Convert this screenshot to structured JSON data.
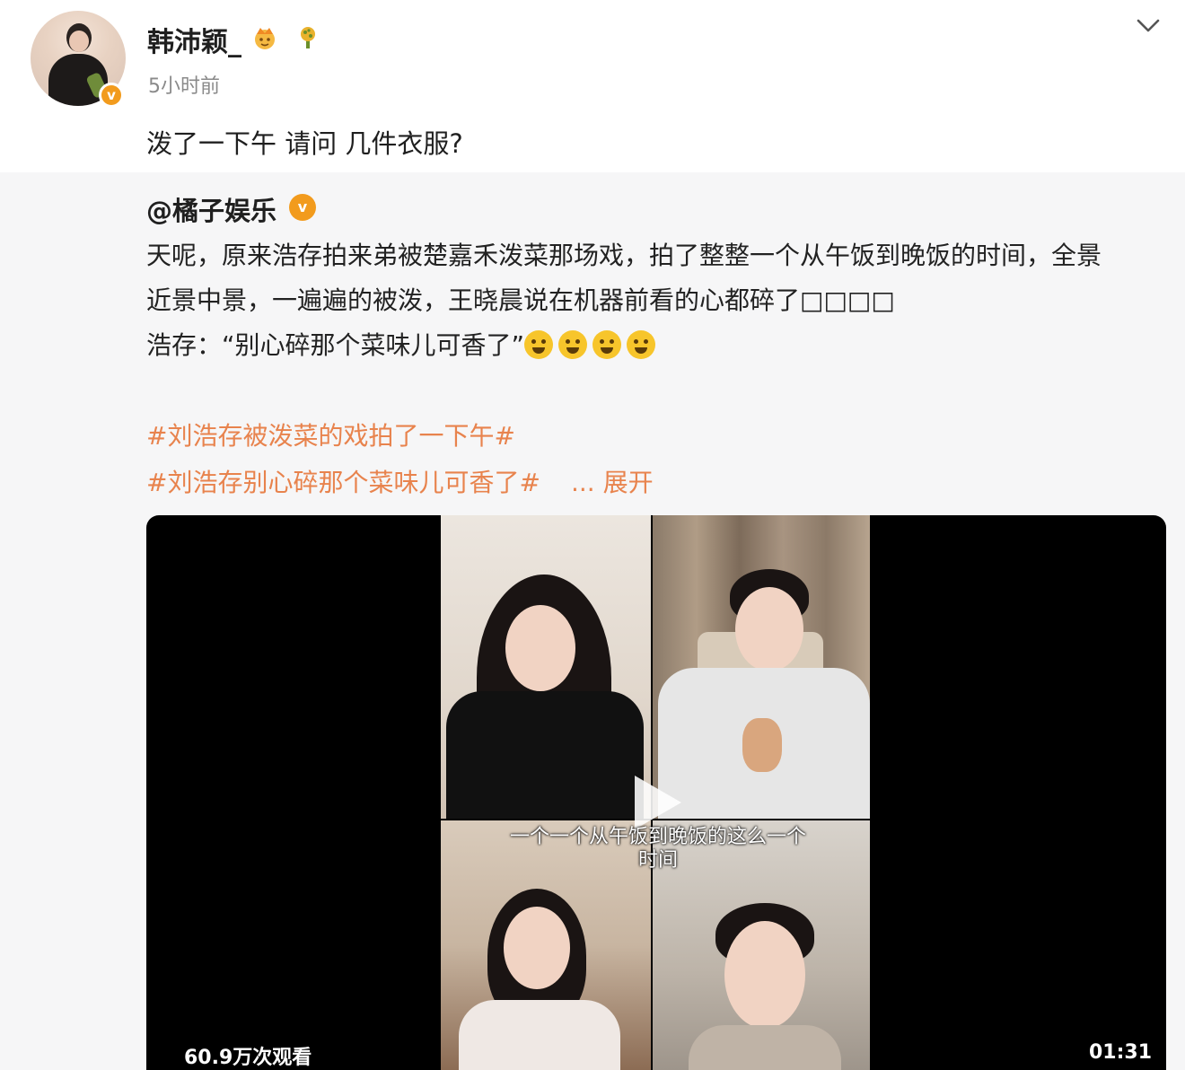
{
  "post": {
    "username": "韩沛颖_",
    "time": "5小时前",
    "text": "泼了一下午 请问 几件衣服?",
    "verify_badge": "v"
  },
  "repost": {
    "author": "@橘子娱乐",
    "badge": "v",
    "lines": [
      "天呢，原来浩存拍来弟被楚嘉禾泼菜那场戏，拍了整整一个从午饭到晚饭的时间，全景",
      "近景中景，一遍遍的被泼，王晓晨说在机器前看的心都碎了□□□□",
      "浩存：“别心碎那个菜味儿可香了”"
    ],
    "emoji_count": 4,
    "hashtags": [
      "#刘浩存被泼菜的戏拍了一下午#",
      "#刘浩存别心碎那个菜味儿可香了#"
    ],
    "expand": "... 展开"
  },
  "video": {
    "subtitle_line1": "一个一个从午饭到晚饭的这么一个",
    "subtitle_line2": "时间",
    "views": "60.9万次观看",
    "duration": "01:31"
  },
  "colors": {
    "accent": "#e8834d",
    "badge": "#f29b1d",
    "repost_bg": "#f6f6f7"
  },
  "icons": [
    "crown-icon",
    "plant-icon",
    "chevron-down-icon",
    "verified-icon",
    "laugh-cry-emoji",
    "play-icon"
  ]
}
